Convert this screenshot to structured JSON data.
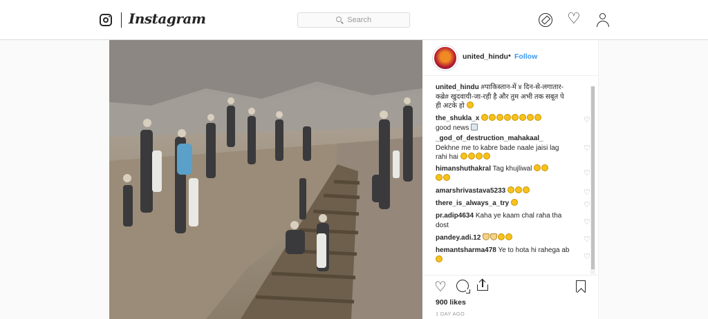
{
  "nav": {
    "logo_text": "Instagram",
    "search_placeholder": "Search",
    "icons": [
      "instagram-camera-icon",
      "compass-icon",
      "heart-icon",
      "profile-icon"
    ]
  },
  "post": {
    "username": "united_hindu",
    "dot": "•",
    "follow_label": "Follow",
    "caption_user": "united_hindu",
    "caption_text": "#पाकिस्तान-में ४ दिन-से-लगातार-कब्रे# खुदवायी-जा-रही है और तुम अभी तक सबूत पे ही अटके हो",
    "comments": [
      {
        "user": "the_shukla_x",
        "text": "good news"
      },
      {
        "user": "_god_of_destruction_mahakaal_",
        "text": "Dekhne me to kabre bade naale jaisi lag rahi hai"
      },
      {
        "user": "himanshuthakral",
        "text": "Tag khujliwal"
      },
      {
        "user": "amarshrivastava5233",
        "text": ""
      },
      {
        "user": "there_is_always_a_try",
        "text": ""
      },
      {
        "user": "pr.adip4634",
        "text": "Kaha ye kaam chal raha tha dost"
      },
      {
        "user": "pandey.adi.12",
        "text": ""
      },
      {
        "user": "hemantsharma478",
        "text": "Ye to hota hi rahega ab"
      }
    ],
    "likes": "900 likes",
    "timestamp": "1 DAY AGO"
  },
  "colors": {
    "link_blue": "#3897f0",
    "text_dark": "#262626",
    "muted": "#999999",
    "border": "#dbdbdb"
  }
}
